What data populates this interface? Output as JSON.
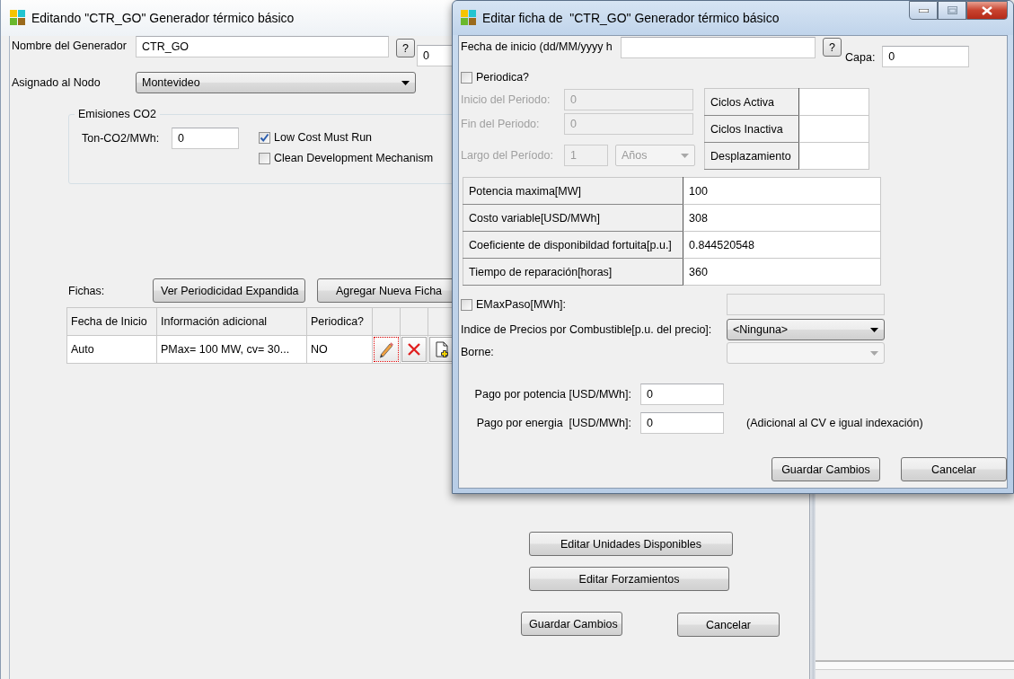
{
  "main_window": {
    "title": "Editando \"CTR_GO\" Generador térmico básico",
    "name_label": "Nombre del Generador",
    "name_value": "CTR_GO",
    "help_button": "?",
    "capa_value": "0",
    "node_label": "Asignado al Nodo",
    "node_value": "Montevideo",
    "emissions": {
      "title": "Emisiones CO2",
      "ton_label": "Ton-CO2/MWh:",
      "ton_value": "0",
      "checkboxes": [
        {
          "label": "Low Cost Must Run",
          "checked": true
        },
        {
          "label": "Clean Development Mechanism",
          "checked": false
        }
      ]
    },
    "fichas": {
      "label": "Fichas:",
      "buttons": [
        "Ver Periodicidad Expandida",
        "Agregar Nueva Ficha"
      ],
      "columns": [
        "Fecha de Inicio",
        "Información adicional",
        "Periodica?"
      ],
      "rows": [
        [
          "Auto",
          "PMax= 100 MW, cv= 30...",
          "NO"
        ]
      ]
    },
    "side_buttons": [
      "Editar Unidades Disponibles",
      "Editar Forzamientos"
    ],
    "buttons": [
      "Guardar Cambios",
      "Cancelar"
    ]
  },
  "dialog": {
    "title": "Editar ficha de  \"CTR_GO\" Generador térmico básico",
    "start_date_label": "Fecha de inicio (dd/MM/yyyy h",
    "help_button": "?",
    "capa_label": "Capa:",
    "capa_value": "0",
    "periodic": {
      "label": "Periodica?",
      "checked": false
    },
    "period_fields": [
      {
        "label": "Inicio del Periodo:",
        "value": "0",
        "disabled": true
      },
      {
        "label": "Fin del Periodo:",
        "value": "0",
        "disabled": true
      }
    ],
    "period_length": {
      "label": "Largo del Período:",
      "value": "1",
      "unit": "Años",
      "disabled": true
    },
    "cycles": [
      "Ciclos Activa",
      "Ciclos Inactiva",
      "Desplazamiento"
    ],
    "properties": [
      {
        "name": "Potencia maxima[MW]",
        "value": "100"
      },
      {
        "name": "Costo variable[USD/MWh]",
        "value": "308"
      },
      {
        "name": "Coeficiente de disponibildad fortuita[p.u.]",
        "value": "0.844520548"
      },
      {
        "name": "Tiempo de reparación[horas]",
        "value": "360"
      }
    ],
    "emax": {
      "label": "EMaxPaso[MWh]:",
      "checked": false,
      "disabled": true
    },
    "fuel_index": {
      "label": "Indice de Precios por Combustible[p.u. del precio]:",
      "value": "<Ninguna>"
    },
    "borne": {
      "label": "Borne:",
      "disabled": true
    },
    "payments": [
      {
        "label": "Pago por potencia [USD/MWh]:",
        "value": "0"
      },
      {
        "label": "Pago por energia  [USD/MWh]:",
        "value": "0",
        "note": "(Adicional al CV e igual indexación)"
      }
    ],
    "buttons": [
      "Guardar Cambios",
      "Cancelar"
    ]
  }
}
